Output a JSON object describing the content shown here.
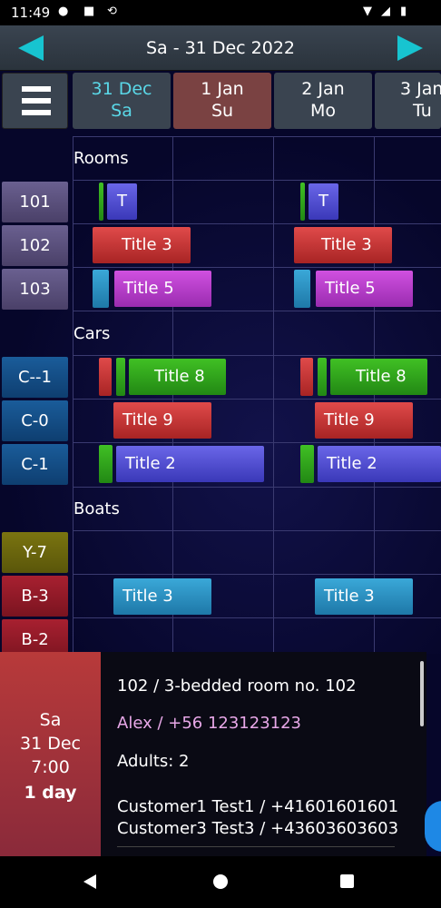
{
  "status": {
    "time": "11:49"
  },
  "header": {
    "title": "Sa - 31 Dec 2022"
  },
  "days": [
    {
      "date": "31 Dec",
      "weekday": "Sa"
    },
    {
      "date": "1 Jan",
      "weekday": "Su"
    },
    {
      "date": "2 Jan",
      "weekday": "Mo"
    },
    {
      "date": "3 Jan",
      "weekday": "Tu"
    }
  ],
  "sections": {
    "rooms": "Rooms",
    "cars": "Cars",
    "boats": "Boats"
  },
  "rows": {
    "r101": "101",
    "r102": "102",
    "r103": "103",
    "c_1": "C--1",
    "c0": "C-0",
    "c1": "C-1",
    "y7": "Y-7",
    "b3": "B-3",
    "b2": "B-2"
  },
  "events": {
    "t": "T",
    "title3": "Title 3",
    "title5": "Title 5",
    "title8": "Title 8",
    "title9": "Title 9",
    "title2": "Title 2"
  },
  "panel": {
    "weekday": "Sa",
    "date": "31 Dec",
    "time": "7:00",
    "duration": "1 day",
    "room": "102  /  3-bedded room no. 102",
    "guest": "Alex / +56 123123123",
    "adults": "Adults: 2",
    "customer1": "Customer1 Test1 / +41601601601",
    "customer3": "Customer3 Test3 / +43603603603"
  },
  "colors": {
    "accent": "#17c4d0",
    "guest_text": "#e8a8e8",
    "today": "#5ad8e8"
  }
}
